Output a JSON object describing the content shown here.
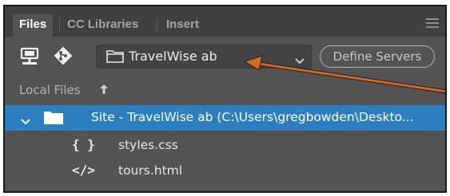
{
  "tabs": [
    {
      "label": "Files",
      "active": true
    },
    {
      "label": "CC Libraries",
      "active": false
    },
    {
      "label": "Insert",
      "active": false
    }
  ],
  "toolbar": {
    "connect_icon": "monitor-connect-icon",
    "git_icon": "git-icon",
    "site_select_value": "TravelWise ab",
    "define_servers_label": "Define Servers"
  },
  "files_header": {
    "label": "Local Files",
    "sort_icon": "sort-up-arrow-icon"
  },
  "tree": {
    "site_label": "Site - TravelWise ab (C:\\Users\\gregbowden\\Deskto...",
    "files": [
      {
        "icon": "{ }",
        "name": "styles.css"
      },
      {
        "icon": "</>",
        "name": "tours.html"
      }
    ]
  },
  "annotation": {
    "color": "#d2691e"
  },
  "colors": {
    "panel_bg": "#535353",
    "tab_bar_bg": "#404040",
    "selection_bg": "#2d7fc0",
    "text": "#e6e6e6"
  }
}
